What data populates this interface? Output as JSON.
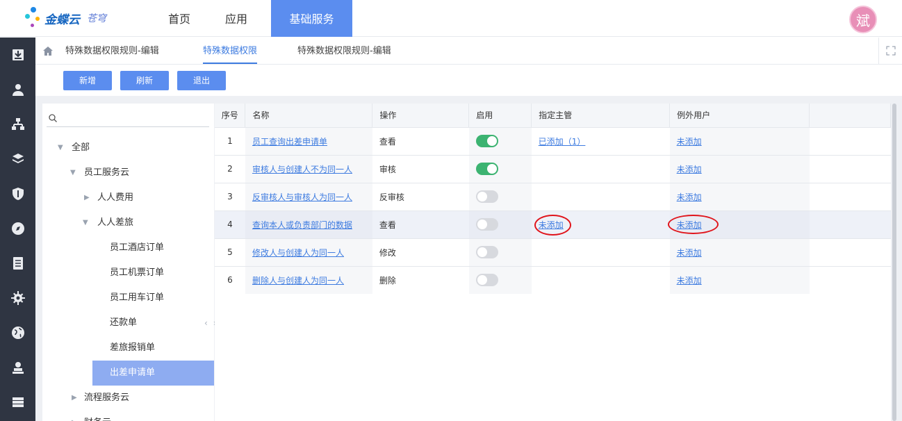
{
  "brand": {
    "name": "金蝶云",
    "sub": "苍穹"
  },
  "topnav": [
    {
      "label": "首页"
    },
    {
      "label": "应用"
    },
    {
      "label": "基础服务",
      "active": true
    }
  ],
  "user": {
    "avatar_text": "斌"
  },
  "rail_icons": [
    "download-icon",
    "user-icon",
    "org-chart-icon",
    "layers-icon",
    "shield-icon",
    "compass-icon",
    "document-icon",
    "gear-icon",
    "globe-icon",
    "person-stamp-icon",
    "server-icon"
  ],
  "tabs": [
    {
      "label": "特殊数据权限规则-编辑"
    },
    {
      "label": "特殊数据权限",
      "active": true
    },
    {
      "label": "特殊数据权限规则-编辑"
    }
  ],
  "toolbar": {
    "add": "新增",
    "refresh": "刷新",
    "exit": "退出"
  },
  "tree": {
    "search_placeholder": "",
    "nodes": [
      {
        "label": "全部",
        "level": 0,
        "arrow": "▼"
      },
      {
        "label": "员工服务云",
        "level": 1,
        "arrow": "▼"
      },
      {
        "label": "人人费用",
        "level": 2,
        "arrow": "▶"
      },
      {
        "label": "人人差旅",
        "level": 2,
        "arrow": "▼"
      },
      {
        "label": "员工酒店订单",
        "level": 3
      },
      {
        "label": "员工机票订单",
        "level": 3
      },
      {
        "label": "员工用车订单",
        "level": 3
      },
      {
        "label": "还款单",
        "level": 3
      },
      {
        "label": "差旅报销单",
        "level": 3
      },
      {
        "label": "出差申请单",
        "level": 3,
        "selected": true
      },
      {
        "label": "流程服务云",
        "level": 1,
        "arrow": "▶"
      },
      {
        "label": "财务云",
        "level": 1,
        "arrow": "▶"
      }
    ]
  },
  "table": {
    "headers": {
      "idx": "序号",
      "name": "名称",
      "op": "操作",
      "enabled": "启用",
      "manager": "指定主管",
      "exception": "例外用户"
    },
    "rows": [
      {
        "idx": "1",
        "name": "员工查询出差申请单",
        "op": "查看",
        "enabled": true,
        "manager": "已添加（1）",
        "exception": "未添加"
      },
      {
        "idx": "2",
        "name": "审核人与创建人不为同一人",
        "op": "审核",
        "enabled": true,
        "manager": "",
        "exception": "未添加"
      },
      {
        "idx": "3",
        "name": "反审核人与审核人为同一人",
        "op": "反审核",
        "enabled": false,
        "manager": "",
        "exception": "未添加"
      },
      {
        "idx": "4",
        "name": "查询本人或负责部门的数据",
        "op": "查看",
        "enabled": false,
        "manager": "未添加",
        "exception": "未添加",
        "highlight": true
      },
      {
        "idx": "5",
        "name": "修改人与创建人为同一人",
        "op": "修改",
        "enabled": false,
        "manager": "",
        "exception": "未添加"
      },
      {
        "idx": "6",
        "name": "删除人与创建人为同一人",
        "op": "删除",
        "enabled": false,
        "manager": "",
        "exception": "未添加"
      }
    ]
  },
  "colors": {
    "accent": "#5b8def",
    "link": "#3d7be0",
    "toggle_on": "#3cb371",
    "annotation": "#e0141b",
    "rail": "#2f3542"
  }
}
